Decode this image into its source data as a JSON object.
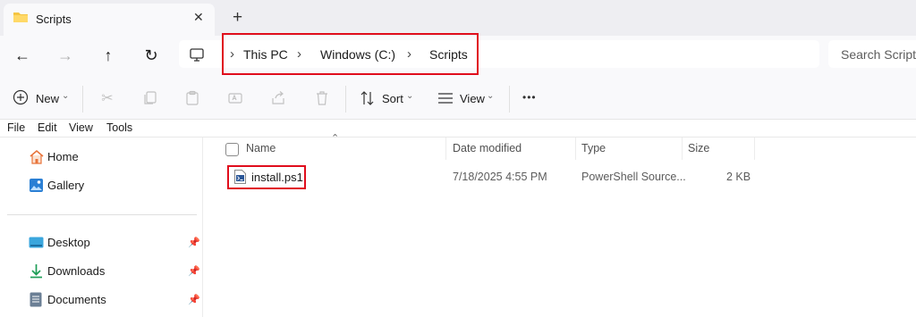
{
  "tab": {
    "title": "Scripts",
    "close_glyph": "✕",
    "new_tab_glyph": "+"
  },
  "navigation": {
    "back_glyph": "←",
    "forward_glyph": "→",
    "up_glyph": "↑",
    "refresh_glyph": "↻"
  },
  "address_bar": {
    "breadcrumbs": [
      "This PC",
      "Windows (C:)",
      "Scripts"
    ],
    "separator": "›"
  },
  "search": {
    "placeholder": "Search Scripts"
  },
  "toolbar": {
    "new_label": "New",
    "sort_label": "Sort",
    "view_label": "View",
    "more_label": "•••",
    "chevron": "⌄"
  },
  "menu_bar": {
    "items": [
      "File",
      "Edit",
      "View",
      "Tools"
    ]
  },
  "sidebar": {
    "items": [
      {
        "label": "Home",
        "icon": "home-icon"
      },
      {
        "label": "Gallery",
        "icon": "gallery-icon"
      },
      {
        "label": "Desktop",
        "icon": "desktop-icon",
        "pinned": true
      },
      {
        "label": "Downloads",
        "icon": "downloads-icon",
        "pinned": true
      },
      {
        "label": "Documents",
        "icon": "documents-icon",
        "pinned": true
      }
    ]
  },
  "file_list": {
    "columns": [
      "Name",
      "Date modified",
      "Type",
      "Size"
    ],
    "rows": [
      {
        "name": "install.ps1",
        "date_modified": "7/18/2025 4:55 PM",
        "type": "PowerShell Source...",
        "size": "2 KB"
      }
    ]
  },
  "colors": {
    "highlight": "#e00d1c",
    "folder": "#f5c542",
    "accent": "#0067c0"
  }
}
